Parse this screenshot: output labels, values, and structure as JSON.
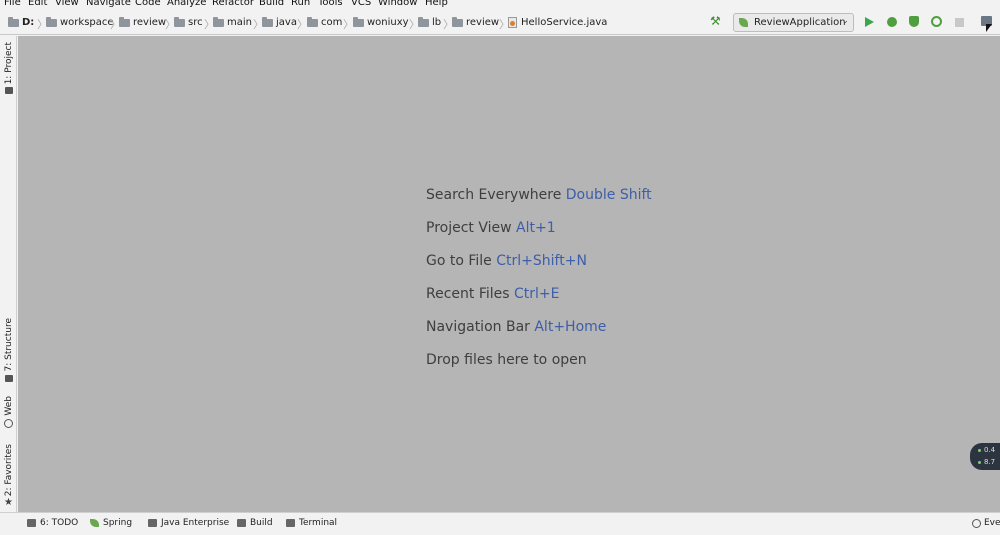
{
  "menu": [
    "File",
    "Edit",
    "View",
    "Navigate",
    "Code",
    "Analyze",
    "Refactor",
    "Build",
    "Run",
    "Tools",
    "VCS",
    "Window",
    "Help"
  ],
  "breadcrumbs": [
    "D:",
    "workspace",
    "review",
    "src",
    "main",
    "java",
    "com",
    "woniuxy",
    "lb",
    "review",
    "HelloService.java"
  ],
  "run_config": "ReviewApplication",
  "left_tabs": {
    "project": "1: Project",
    "structure": "7: Structure",
    "web": "Web",
    "favorites": "2: Favorites"
  },
  "hints": [
    {
      "text": "Search Everywhere ",
      "key": "Double Shift"
    },
    {
      "text": "Project View ",
      "key": "Alt+1"
    },
    {
      "text": "Go to File ",
      "key": "Ctrl+Shift+N"
    },
    {
      "text": "Recent Files ",
      "key": "Ctrl+E"
    },
    {
      "text": "Navigation Bar ",
      "key": "Alt+Home"
    },
    {
      "text": "Drop files here to open",
      "key": ""
    }
  ],
  "memory": [
    "0.4",
    "8.7"
  ],
  "bottom_tabs": {
    "todo": "6: TODO",
    "spring": "Spring",
    "java_enterprise": "Java Enterprise",
    "build": "Build",
    "terminal": "Terminal"
  },
  "event_log": "Eve",
  "colors": {
    "key": "#3d5ea8",
    "editor_bg": "#b5b5b5",
    "run": "#3aa84a"
  }
}
